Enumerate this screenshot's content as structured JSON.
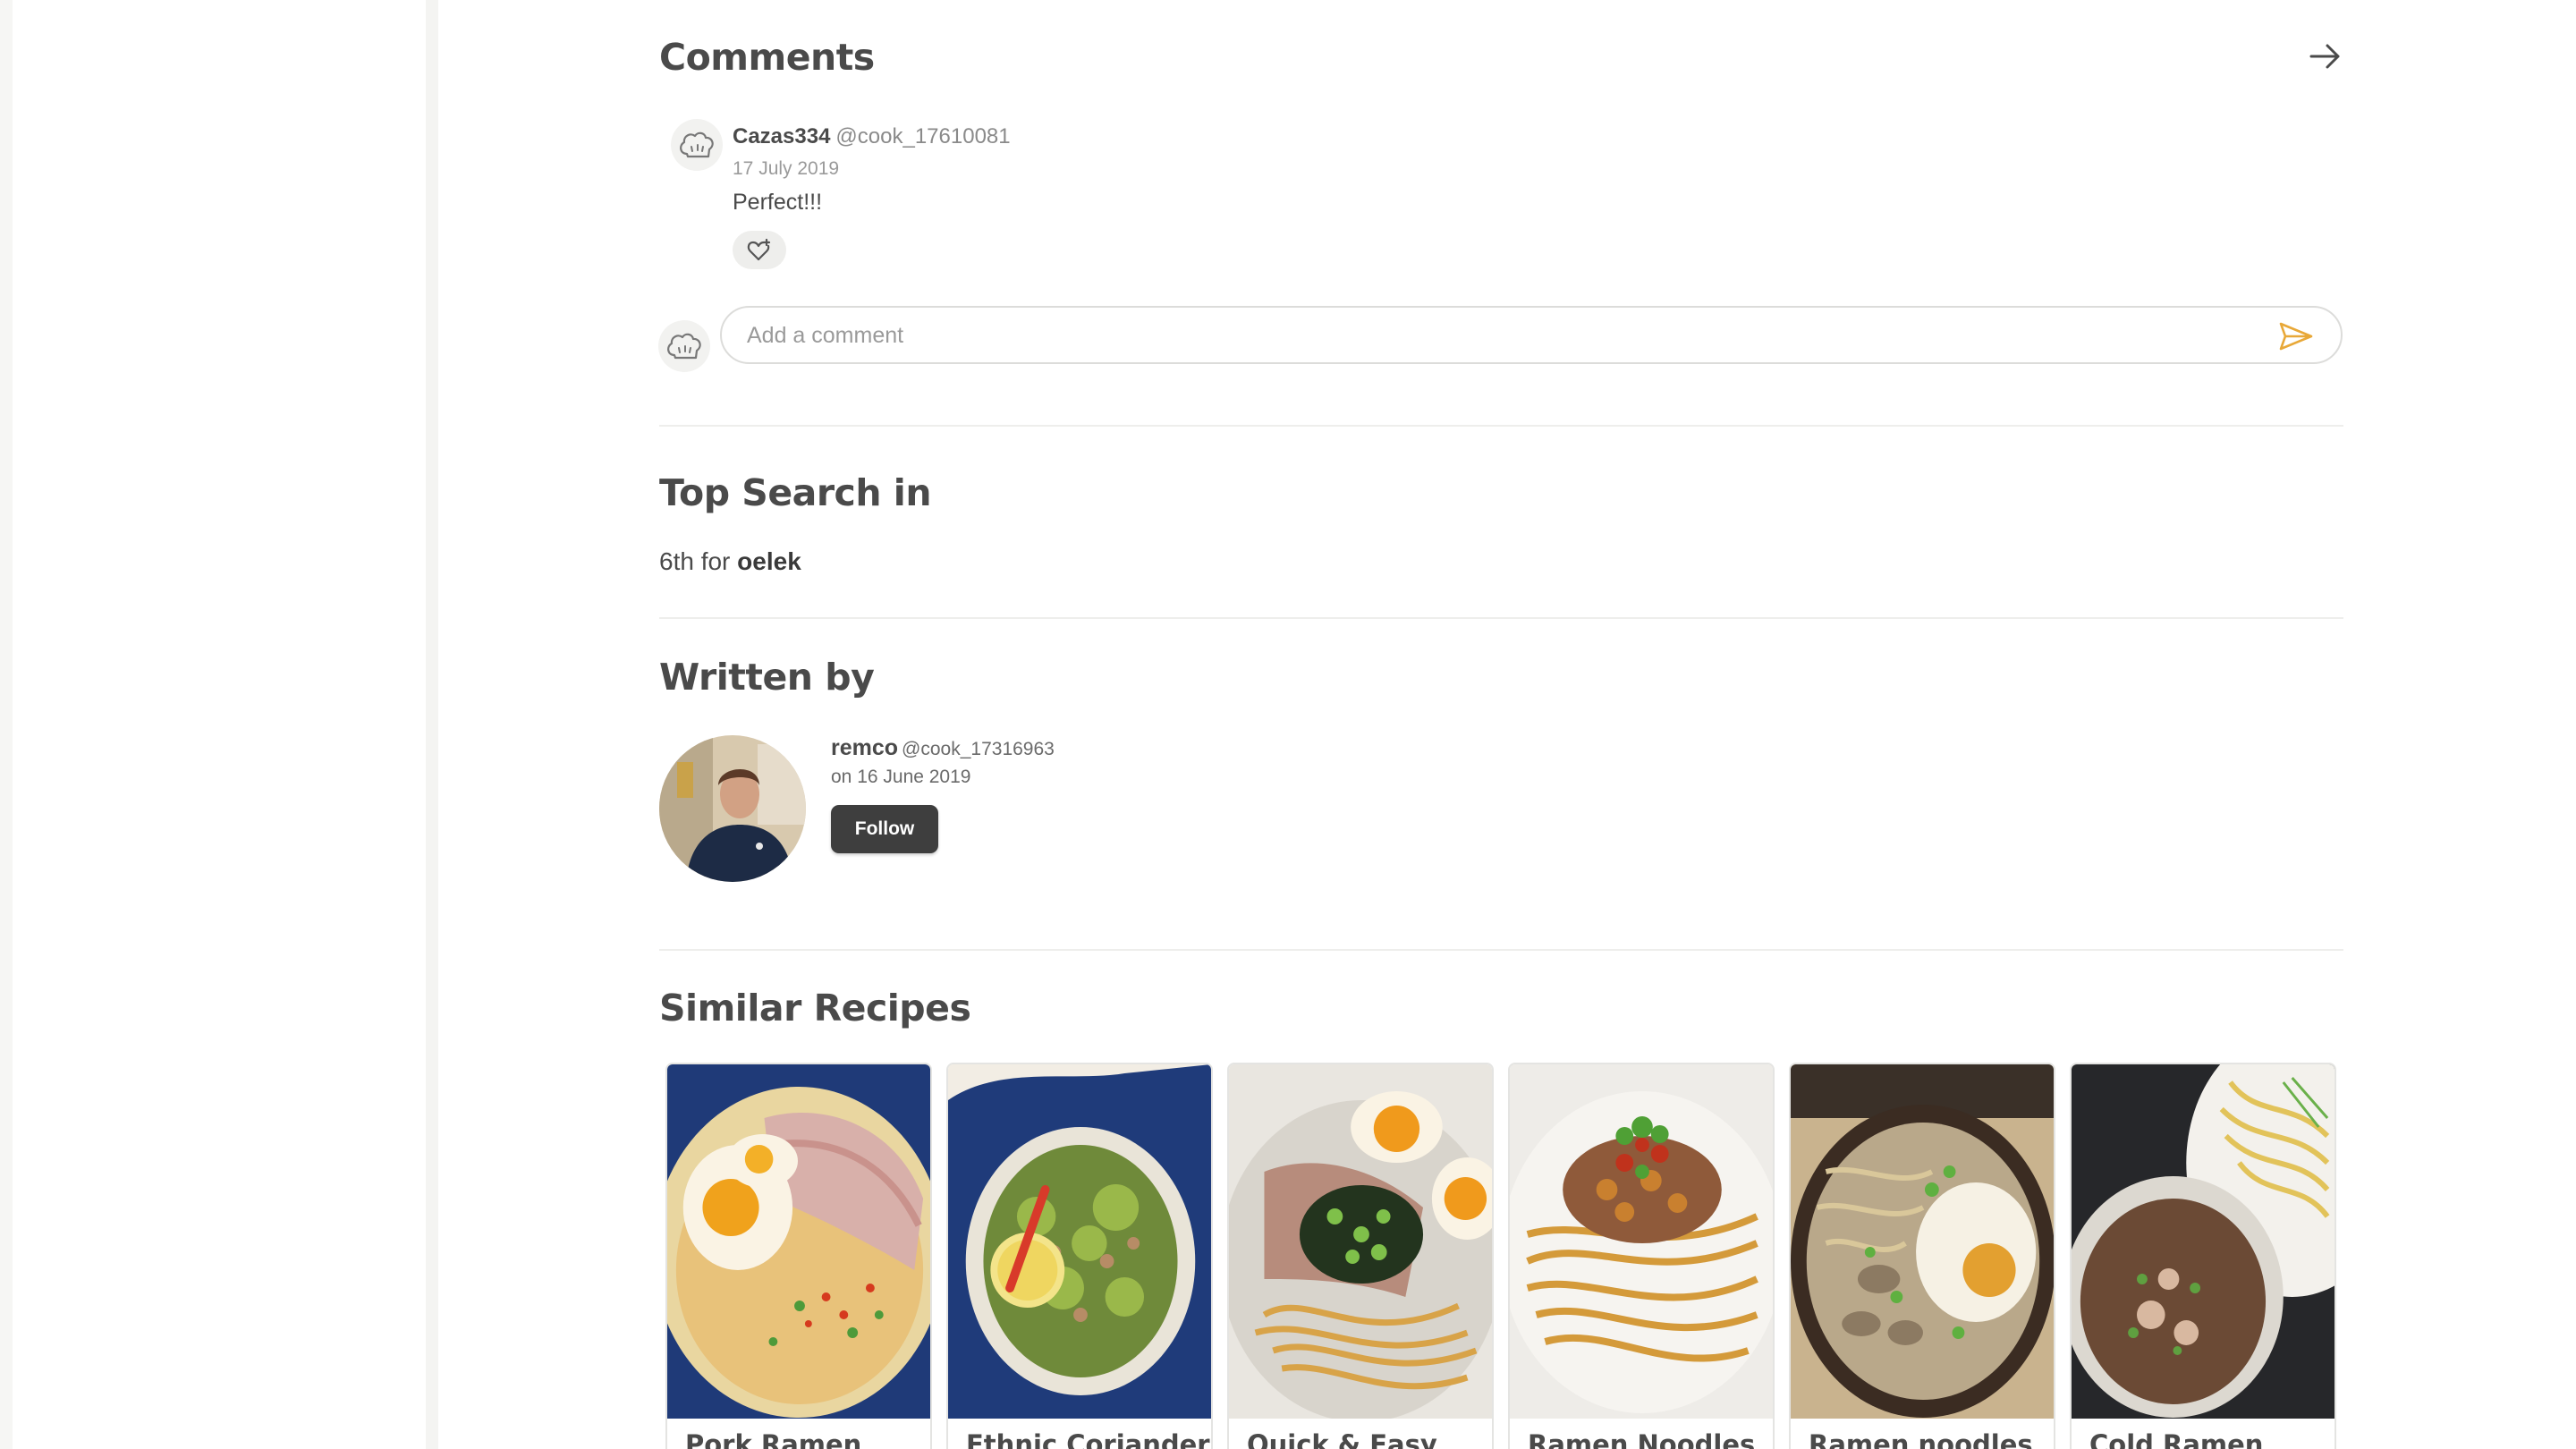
{
  "comments": {
    "title": "Comments",
    "items": [
      {
        "author_name": "Cazas334",
        "author_handle": "@cook_17610081",
        "date": "17 July 2019",
        "text": "Perfect!!!"
      }
    ],
    "input_placeholder": "Add a comment"
  },
  "top_search": {
    "title": "Top Search in",
    "rank_prefix": "6th for",
    "keyword": "oelek"
  },
  "written_by": {
    "title": "Written by",
    "author_name": "remco",
    "author_handle": "@cook_17316963",
    "date": "on 16 June 2019",
    "follow_label": "Follow"
  },
  "similar_recipes": {
    "title": "Similar Recipes",
    "items": [
      {
        "title": "Pork Ramen"
      },
      {
        "title": "Ethnic Coriander"
      },
      {
        "title": "Quick & Easy"
      },
      {
        "title": "Ramen Noodles"
      },
      {
        "title": "Ramen noodles"
      },
      {
        "title": "Cold Ramen"
      }
    ]
  },
  "colors": {
    "text": "#4a4a4a",
    "muted": "#9a9a9a",
    "accent": "#e8a838",
    "follow_bg": "#3e3e3e"
  }
}
